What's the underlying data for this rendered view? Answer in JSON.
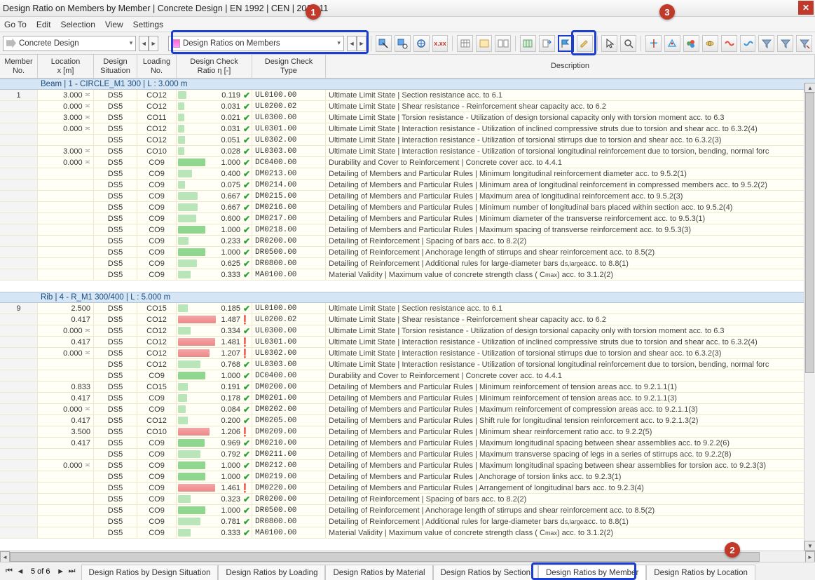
{
  "window": {
    "title": "Design Ratio on Members by Member | Concrete Design | EN 1992 | CEN | 2014-11"
  },
  "menus": [
    "Go To",
    "Edit",
    "Selection",
    "View",
    "Settings"
  ],
  "module_combo": "Concrete Design",
  "result_combo": "Design Ratios on Members",
  "annotations": {
    "a1": "1",
    "a2": "2",
    "a3": "3"
  },
  "columns": {
    "no": "Member\nNo.",
    "loc": "Location\nx [m]",
    "sit": "Design\nSituation",
    "load": "Loading\nNo.",
    "ratio": "Design Check\nRatio η [-]",
    "code": "Design Check\nType",
    "desc": "Description"
  },
  "groups": [
    {
      "no": "1",
      "header": "Beam | 1 - CIRCLE_M1 300 | L : 3.000 m",
      "rows": [
        {
          "loc": "3.000",
          "m": true,
          "sit": "DS5",
          "load": "CO12",
          "ratio": 0.119,
          "ok": true,
          "code": "UL0100.00",
          "desc": "Ultimate Limit State | Section resistance acc. to 6.1"
        },
        {
          "loc": "0.000",
          "m": true,
          "sit": "DS5",
          "load": "CO12",
          "ratio": 0.031,
          "ok": true,
          "code": "UL0200.02",
          "desc": "Ultimate Limit State | Shear resistance - Reinforcement shear capacity acc. to 6.2"
        },
        {
          "loc": "3.000",
          "m": true,
          "sit": "DS5",
          "load": "CO11",
          "ratio": 0.021,
          "ok": true,
          "code": "UL0300.00",
          "desc": "Ultimate Limit State | Torsion resistance - Utilization of design torsional capacity only with torsion moment acc. to 6.3"
        },
        {
          "loc": "0.000",
          "m": true,
          "sit": "DS5",
          "load": "CO12",
          "ratio": 0.031,
          "ok": true,
          "code": "UL0301.00",
          "desc": "Ultimate Limit State | Interaction resistance - Utilization of inclined compressive struts due to torsion and shear acc. to 6.3.2(4)"
        },
        {
          "loc": "",
          "m": false,
          "sit": "DS5",
          "load": "CO12",
          "ratio": 0.051,
          "ok": true,
          "code": "UL0302.00",
          "desc": "Ultimate Limit State | Interaction resistance - Utilization of torsional stirrups due to torsion and shear acc. to 6.3.2(3)"
        },
        {
          "loc": "3.000",
          "m": true,
          "sit": "DS5",
          "load": "CO10",
          "ratio": 0.028,
          "ok": true,
          "code": "UL0303.00",
          "desc": "Ultimate Limit State | Interaction resistance - Utilization of torsional longitudinal reinforcement due to torsion, bending, normal forc"
        },
        {
          "loc": "0.000",
          "m": true,
          "sit": "DS5",
          "load": "CO9",
          "ratio": 1.0,
          "ok": true,
          "code": "DC0400.00",
          "desc": "Durability and Cover to Reinforcement | Concrete cover acc. to 4.4.1"
        },
        {
          "loc": "",
          "m": false,
          "sit": "DS5",
          "load": "CO9",
          "ratio": 0.4,
          "ok": true,
          "code": "DM0213.00",
          "desc": "Detailing of Members and Particular Rules | Minimum longitudinal reinforcement diameter acc. to 9.5.2(1)"
        },
        {
          "loc": "",
          "m": false,
          "sit": "DS5",
          "load": "CO9",
          "ratio": 0.075,
          "ok": true,
          "code": "DM0214.00",
          "desc": "Detailing of Members and Particular Rules | Minimum area of longitudinal reinforcement in compressed members acc. to 9.5.2(2)"
        },
        {
          "loc": "",
          "m": false,
          "sit": "DS5",
          "load": "CO9",
          "ratio": 0.667,
          "ok": true,
          "code": "DM0215.00",
          "desc": "Detailing of Members and Particular Rules | Maximum area of longitudinal reinforcement acc. to 9.5.2(3)"
        },
        {
          "loc": "",
          "m": false,
          "sit": "DS5",
          "load": "CO9",
          "ratio": 0.667,
          "ok": true,
          "code": "DM0216.00",
          "desc": "Detailing of Members and Particular Rules | Minimum number of longitudinal bars placed within section acc. to 9.5.2(4)"
        },
        {
          "loc": "",
          "m": false,
          "sit": "DS5",
          "load": "CO9",
          "ratio": 0.6,
          "ok": true,
          "code": "DM0217.00",
          "desc": "Detailing of Members and Particular Rules | Minimum diameter of the transverse reinforcement acc. to 9.5.3(1)"
        },
        {
          "loc": "",
          "m": false,
          "sit": "DS5",
          "load": "CO9",
          "ratio": 1.0,
          "ok": true,
          "code": "DM0218.00",
          "desc": "Detailing of Members and Particular Rules | Maximum spacing of transverse reinforcement acc. to 9.5.3(3)"
        },
        {
          "loc": "",
          "m": false,
          "sit": "DS5",
          "load": "CO9",
          "ratio": 0.233,
          "ok": true,
          "code": "DR0200.00",
          "desc": "Detailing of Reinforcement | Spacing of bars acc. to 8.2(2)"
        },
        {
          "loc": "",
          "m": false,
          "sit": "DS5",
          "load": "CO9",
          "ratio": 1.0,
          "ok": true,
          "code": "DR0500.00",
          "desc": "Detailing of Reinforcement | Anchorage length of stirrups and shear reinforcement acc. to 8.5(2)"
        },
        {
          "loc": "",
          "m": false,
          "sit": "DS5",
          "load": "CO9",
          "ratio": 0.625,
          "ok": true,
          "code": "DR0800.00",
          "desc": "Detailing of Reinforcement | Additional rules for large-diameter bars d<sub>s,large</sub> acc. to 8.8(1)"
        },
        {
          "loc": "",
          "m": false,
          "sit": "DS5",
          "load": "CO9",
          "ratio": 0.333,
          "ok": true,
          "code": "MA0100.00",
          "desc": "Material Validity | Maximum value of concrete strength class ( C<sub>max</sub> ) acc. to 3.1.2(2)"
        }
      ]
    },
    {
      "no": "9",
      "header": "Rib | 4 - R_M1 300/400 | L : 5.000 m",
      "rows": [
        {
          "loc": "2.500",
          "m": false,
          "sit": "DS5",
          "load": "CO15",
          "ratio": 0.185,
          "ok": true,
          "code": "UL0100.00",
          "desc": "Ultimate Limit State | Section resistance acc. to 6.1"
        },
        {
          "loc": "0.417",
          "m": false,
          "sit": "DS5",
          "load": "CO12",
          "ratio": 1.487,
          "ok": false,
          "code": "UL0200.02",
          "desc": "Ultimate Limit State | Shear resistance - Reinforcement shear capacity acc. to 6.2"
        },
        {
          "loc": "0.000",
          "m": true,
          "sit": "DS5",
          "load": "CO12",
          "ratio": 0.334,
          "ok": true,
          "code": "UL0300.00",
          "desc": "Ultimate Limit State | Torsion resistance - Utilization of design torsional capacity only with torsion moment acc. to 6.3"
        },
        {
          "loc": "0.417",
          "m": false,
          "sit": "DS5",
          "load": "CO12",
          "ratio": 1.481,
          "ok": false,
          "code": "UL0301.00",
          "desc": "Ultimate Limit State | Interaction resistance - Utilization of inclined compressive struts due to torsion and shear acc. to 6.3.2(4)"
        },
        {
          "loc": "0.000",
          "m": true,
          "sit": "DS5",
          "load": "CO12",
          "ratio": 1.207,
          "ok": false,
          "code": "UL0302.00",
          "desc": "Ultimate Limit State | Interaction resistance - Utilization of torsional stirrups due to torsion and shear acc. to 6.3.2(3)"
        },
        {
          "loc": "",
          "m": false,
          "sit": "DS5",
          "load": "CO12",
          "ratio": 0.768,
          "ok": true,
          "code": "UL0303.00",
          "desc": "Ultimate Limit State | Interaction resistance - Utilization of torsional longitudinal reinforcement due to torsion, bending, normal forc"
        },
        {
          "loc": "",
          "m": false,
          "sit": "DS5",
          "load": "CO9",
          "ratio": 1.0,
          "ok": true,
          "code": "DC0400.00",
          "desc": "Durability and Cover to Reinforcement | Concrete cover acc. to 4.4.1"
        },
        {
          "loc": "0.833",
          "m": false,
          "sit": "DS5",
          "load": "CO15",
          "ratio": 0.191,
          "ok": true,
          "code": "DM0200.00",
          "desc": "Detailing of Members and Particular Rules | Minimum reinforcement of tension areas acc. to 9.2.1.1(1)"
        },
        {
          "loc": "0.417",
          "m": false,
          "sit": "DS5",
          "load": "CO9",
          "ratio": 0.178,
          "ok": true,
          "code": "DM0201.00",
          "desc": "Detailing of Members and Particular Rules | Minimum reinforcement of tension areas acc. to 9.2.1.1(3)"
        },
        {
          "loc": "0.000",
          "m": true,
          "sit": "DS5",
          "load": "CO9",
          "ratio": 0.084,
          "ok": true,
          "code": "DM0202.00",
          "desc": "Detailing of Members and Particular Rules | Maximum reinforcement of compression areas acc. to 9.2.1.1(3)"
        },
        {
          "loc": "0.417",
          "m": false,
          "sit": "DS5",
          "load": "CO12",
          "ratio": 0.2,
          "ok": true,
          "code": "DM0205.00",
          "desc": "Detailing of Members and Particular Rules | Shift rule for longitudinal tension reinforcement acc. to 9.2.1.3(2)"
        },
        {
          "loc": "3.500",
          "m": false,
          "sit": "DS5",
          "load": "CO10",
          "ratio": 1.206,
          "ok": false,
          "code": "DM0209.00",
          "desc": "Detailing of Members and Particular Rules | Minimum shear reinforcement ratio acc. to 9.2.2(5)"
        },
        {
          "loc": "0.417",
          "m": false,
          "sit": "DS5",
          "load": "CO9",
          "ratio": 0.969,
          "ok": true,
          "code": "DM0210.00",
          "desc": "Detailing of Members and Particular Rules | Maximum longitudinal spacing between shear assemblies acc. to 9.2.2(6)"
        },
        {
          "loc": "",
          "m": false,
          "sit": "DS5",
          "load": "CO9",
          "ratio": 0.792,
          "ok": true,
          "code": "DM0211.00",
          "desc": "Detailing of Members and Particular Rules | Maximum transverse spacing of legs in a series of stirrups acc. to 9.2.2(8)"
        },
        {
          "loc": "0.000",
          "m": true,
          "sit": "DS5",
          "load": "CO9",
          "ratio": 1.0,
          "ok": true,
          "code": "DM0212.00",
          "desc": "Detailing of Members and Particular Rules | Maximum longitudinal spacing between shear assemblies for torsion acc. to 9.2.3(3)"
        },
        {
          "loc": "",
          "m": false,
          "sit": "DS5",
          "load": "CO9",
          "ratio": 1.0,
          "ok": true,
          "code": "DM0219.00",
          "desc": "Detailing of Members and Particular Rules | Anchorage of torsion links acc. to 9.2.3(1)"
        },
        {
          "loc": "",
          "m": false,
          "sit": "DS5",
          "load": "CO9",
          "ratio": 1.461,
          "ok": false,
          "code": "DM0220.00",
          "desc": "Detailing of Members and Particular Rules | Arrangement of longitudinal bars acc. to 9.2.3(4)"
        },
        {
          "loc": "",
          "m": false,
          "sit": "DS5",
          "load": "CO9",
          "ratio": 0.323,
          "ok": true,
          "code": "DR0200.00",
          "desc": "Detailing of Reinforcement | Spacing of bars acc. to 8.2(2)"
        },
        {
          "loc": "",
          "m": false,
          "sit": "DS5",
          "load": "CO9",
          "ratio": 1.0,
          "ok": true,
          "code": "DR0500.00",
          "desc": "Detailing of Reinforcement | Anchorage length of stirrups and shear reinforcement acc. to 8.5(2)"
        },
        {
          "loc": "",
          "m": false,
          "sit": "DS5",
          "load": "CO9",
          "ratio": 0.781,
          "ok": true,
          "code": "DR0800.00",
          "desc": "Detailing of Reinforcement | Additional rules for large-diameter bars d<sub>s,large</sub> acc. to 8.8(1)"
        },
        {
          "loc": "",
          "m": false,
          "sit": "DS5",
          "load": "CO9",
          "ratio": 0.333,
          "ok": true,
          "code": "MA0100.00",
          "desc": "Material Validity | Maximum value of concrete strength class ( C<sub>max</sub> ) acc. to 3.1.2(2)"
        }
      ]
    }
  ],
  "pager": "5 of 6",
  "tabs": [
    "Design Ratios by Design Situation",
    "Design Ratios by Loading",
    "Design Ratios by Material",
    "Design Ratios by Section",
    "Design Ratios by Member",
    "Design Ratios by Location"
  ],
  "active_tab": 4
}
